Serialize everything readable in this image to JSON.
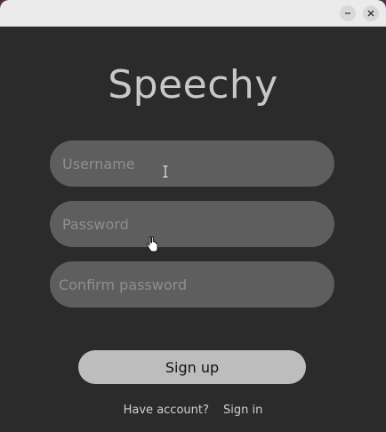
{
  "window": {
    "minimize_icon": "minimize-icon",
    "close_icon": "close-icon"
  },
  "app": {
    "title": "Speechy"
  },
  "form": {
    "username": {
      "value": "",
      "placeholder": "Username"
    },
    "password": {
      "value": "",
      "placeholder": "Password"
    },
    "confirm_password": {
      "value": "",
      "placeholder": "Confirm password"
    },
    "signup_label": "Sign up"
  },
  "footer": {
    "prompt": "Have account?",
    "signin_label": "Sign in"
  },
  "colors": {
    "background": "#2b2b2b",
    "field": "#5e5e5e",
    "button": "#bdbdbd",
    "titlebar": "#ebebeb"
  },
  "cursors": {
    "text_cursor_icon": "text-cursor-icon",
    "pointer_cursor_icon": "hand-pointer-icon"
  }
}
